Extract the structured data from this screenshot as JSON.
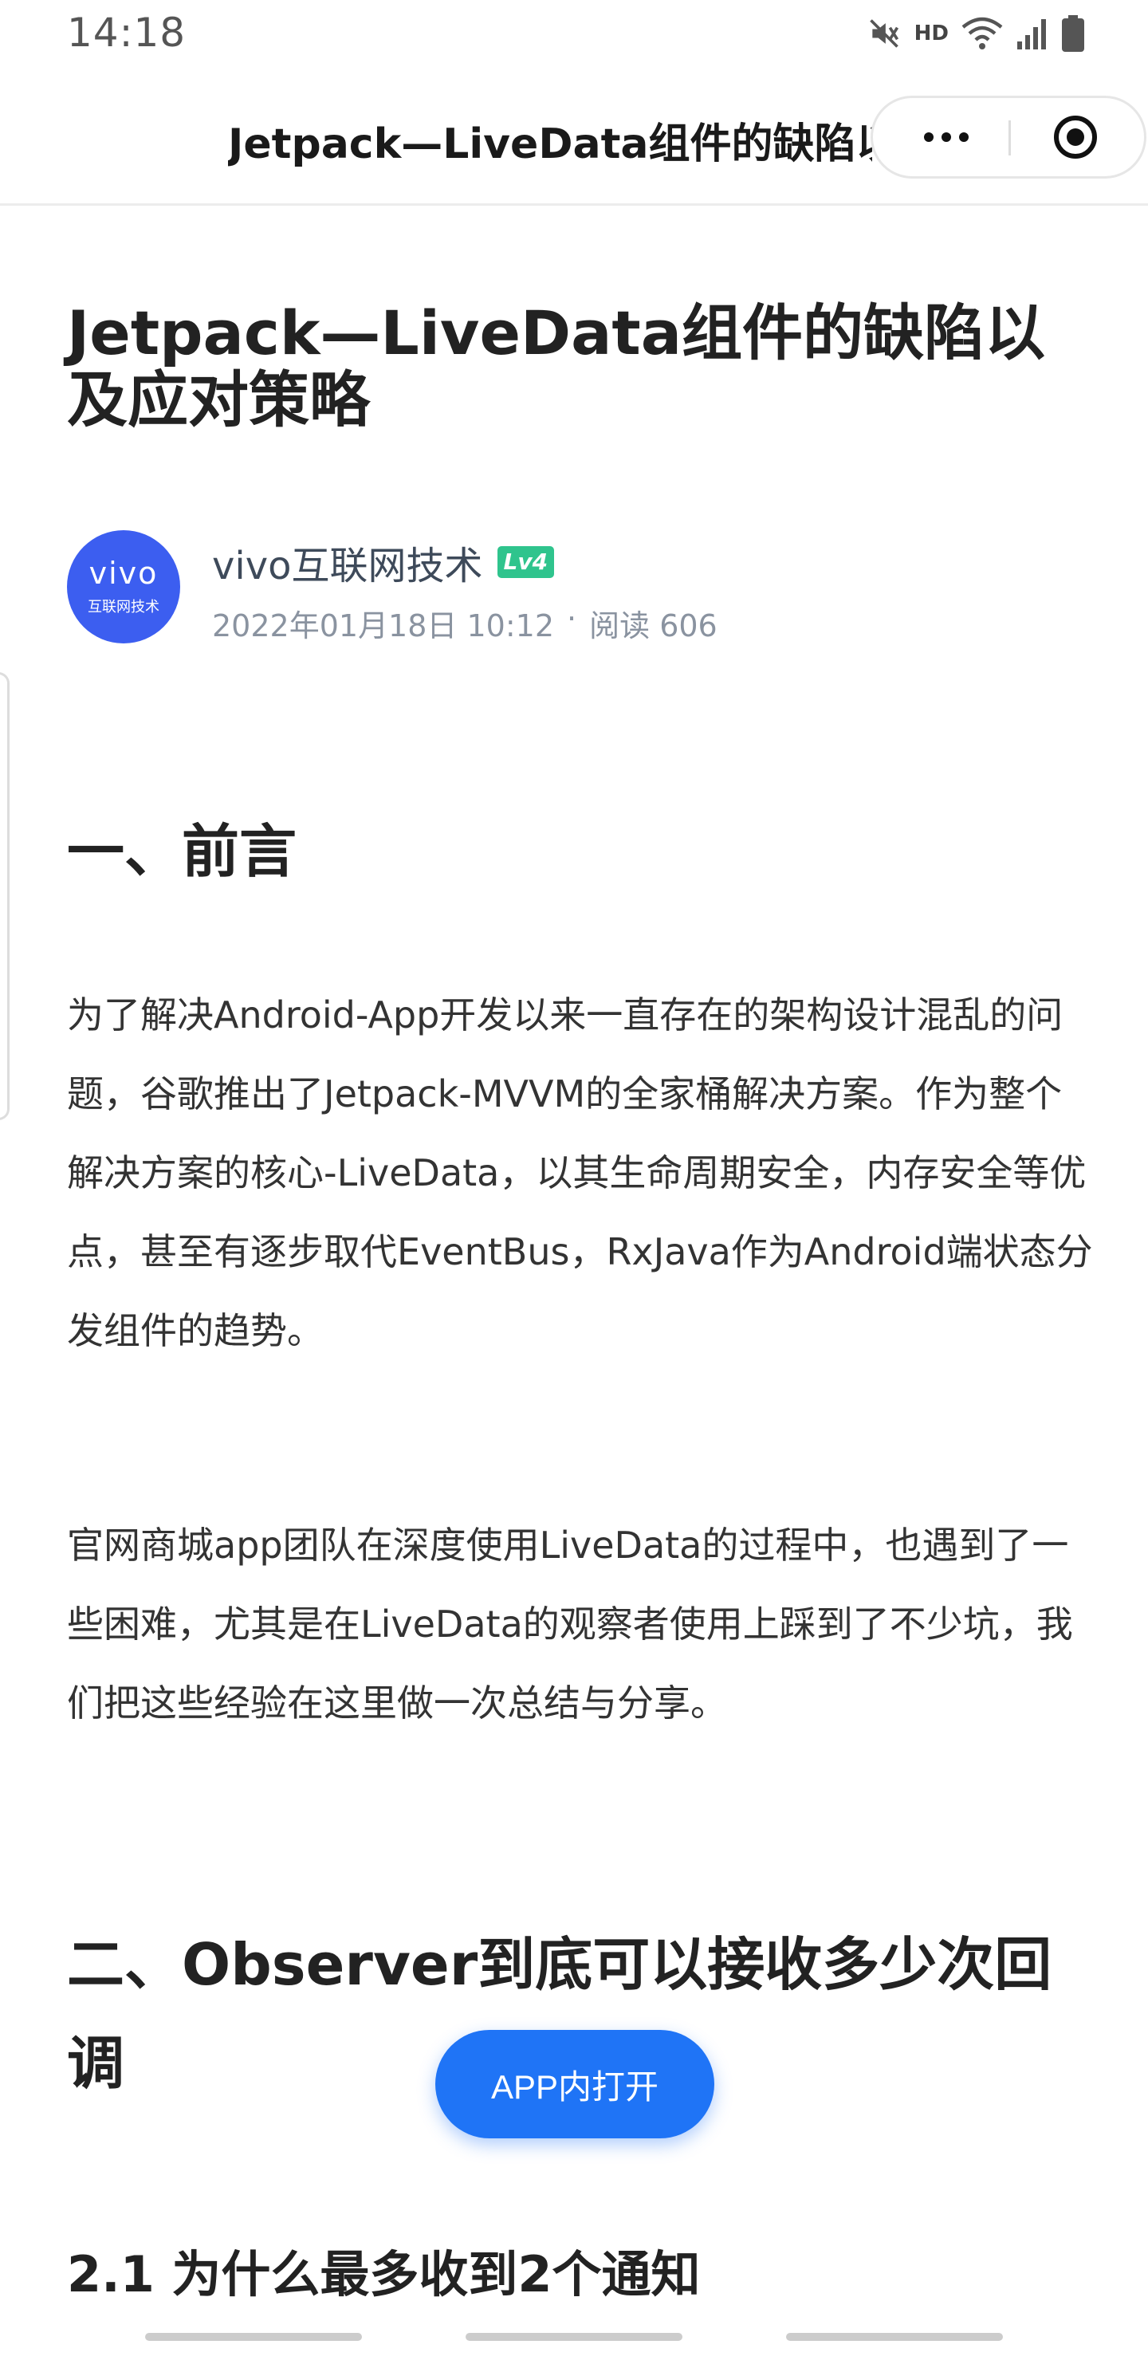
{
  "status_bar": {
    "time": "14:18",
    "hd_label": "HD",
    "icons": [
      "mute-icon",
      "wifi-icon",
      "signal-icon",
      "battery-icon"
    ]
  },
  "nav": {
    "title": "Jetpack—LiveData组件的缺陷以及应对策略",
    "more_icon": "more-dots-icon",
    "close_icon": "close-circle-icon"
  },
  "article": {
    "title": "Jetpack—LiveData组件的缺陷以及应对策略",
    "author": {
      "avatar_logo": "vivo",
      "avatar_subtitle": "互联网技术",
      "name": "vivo互联网技术",
      "level": "Lv4",
      "date": "2022年01月18日 10:12",
      "separator": "·",
      "reads": "阅读 606"
    },
    "section1": {
      "heading": "一、前言",
      "paragraph1": "为了解决Android-App开发以来一直存在的架构设计混乱的问题，谷歌推出了Jetpack-MVVM的全家桶解决方案。作为整个解决方案的核心-LiveData，以其生命周期安全，内存安全等优点，甚至有逐步取代EventBus，RxJava作为Android端状态分发组件的趋势。",
      "paragraph2": "官网商城app团队在深度使用LiveData的过程中，也遇到了一些困难，尤其是在LiveData的观察者使用上踩到了不少坑，我们把这些经验在这里做一次总结与分享。"
    },
    "section2": {
      "heading": "二、Observer到底可以接收多少次回调",
      "subheading": "2.1 为什么最多收到2个通知"
    }
  },
  "app_open_button": "APP内打开",
  "colors": {
    "accent": "#1f74f6",
    "avatar": "#3c5ef0",
    "level_badge": "#2fc48d",
    "meta_text": "#8a93a0"
  }
}
